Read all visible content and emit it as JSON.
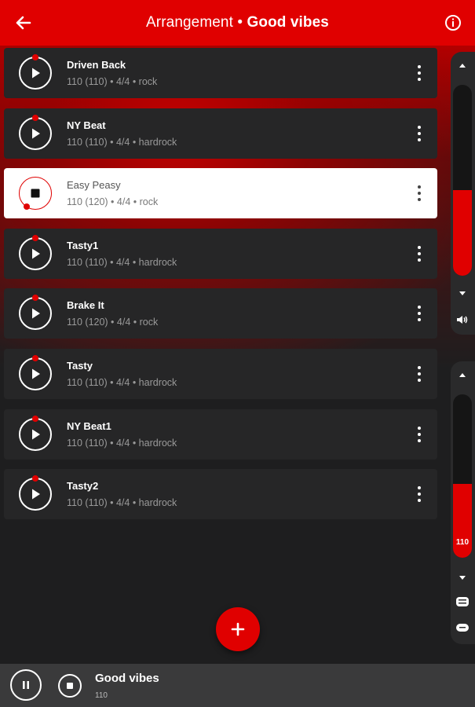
{
  "header": {
    "title_prefix": "Arrangement • ",
    "title_name": "Good vibes",
    "back_icon": "arrow-left-icon",
    "info_icon": "info-icon"
  },
  "songs": [
    {
      "title": "Driven Back",
      "details": "110 (110) • 4/4 • rock",
      "state": "stopped"
    },
    {
      "title": "NY Beat",
      "details": "110 (110) • 4/4 • hardrock",
      "state": "stopped"
    },
    {
      "title": "Easy Peasy",
      "details": "110 (120) • 4/4 • rock",
      "state": "playing"
    },
    {
      "title": "Tasty1",
      "details": "110 (110) • 4/4 • hardrock",
      "state": "stopped"
    },
    {
      "title": "Brake It",
      "details": "110 (120) • 4/4 • rock",
      "state": "stopped"
    },
    {
      "title": "Tasty",
      "details": "110 (110) • 4/4 • hardrock",
      "state": "stopped"
    },
    {
      "title": "NY Beat1",
      "details": "110 (110) • 4/4 • hardrock",
      "state": "stopped"
    },
    {
      "title": "Tasty2",
      "details": "110 (110) • 4/4 • hardrock",
      "state": "stopped"
    }
  ],
  "volume": {
    "level": 0.45,
    "icon": "speaker-icon"
  },
  "tempo": {
    "value": "110",
    "level": 0.45,
    "icons": [
      "bpm-icon",
      "tap-icon"
    ]
  },
  "fab": {
    "icon": "plus-icon"
  },
  "player": {
    "title": "Good vibes",
    "tempo": "110",
    "icons": [
      "pause-icon",
      "stop-icon"
    ]
  },
  "colors": {
    "accent": "#e00000",
    "card": "#262627",
    "background": "#1e1e1f",
    "bottom_bar": "#3a3a3b"
  }
}
